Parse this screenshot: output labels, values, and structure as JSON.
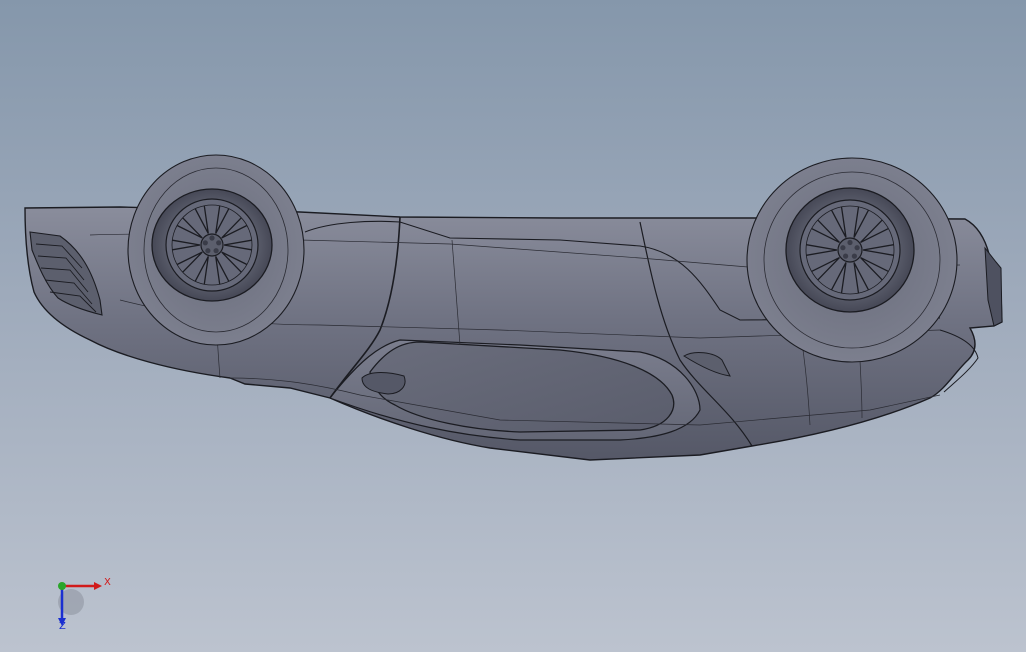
{
  "viewport": {
    "background_top": "#8597ab",
    "background_bottom": "#bcc3cf",
    "model_body_color": "#6f7282",
    "model_edge_color": "#1b1c22"
  },
  "triad": {
    "x_label": "X",
    "z_label": "Z",
    "x_color": "#d11a1a",
    "y_color": "#2aa52a",
    "z_color": "#1a2fd1"
  }
}
